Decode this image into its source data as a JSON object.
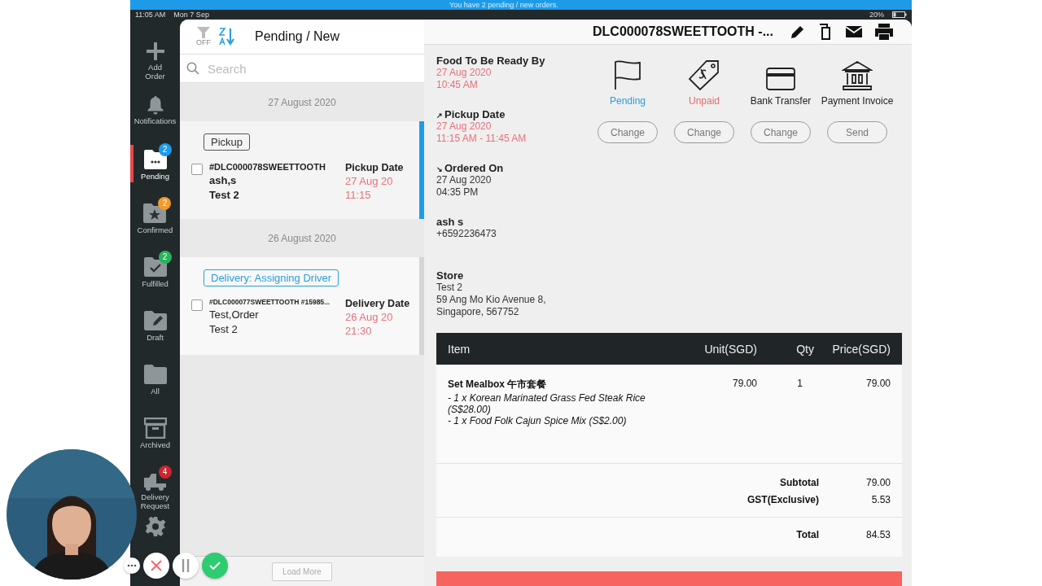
{
  "status_bar": {
    "banner": "You have 2 pending / new orders.",
    "time": "11:05 AM",
    "date": "Mon 7 Sep",
    "battery": "20%"
  },
  "sidebar": {
    "items": [
      {
        "kind": "plus",
        "label": "Add Order",
        "selected": false
      },
      {
        "kind": "bell",
        "label": "Notifications",
        "selected": false
      },
      {
        "kind": "folder-dots",
        "label": "Pending",
        "badge": "2",
        "color": "#1e9be8",
        "selected": true
      },
      {
        "kind": "folder-star",
        "label": "Confirmed",
        "badge": "2",
        "color": "#f39a2b",
        "selected": false
      },
      {
        "kind": "folder-check",
        "label": "Fulfilled",
        "badge": "2",
        "color": "#27b45a",
        "selected": false
      },
      {
        "kind": "folder-pencil",
        "label": "Draft",
        "selected": false
      },
      {
        "kind": "folder",
        "label": "All",
        "selected": false
      },
      {
        "kind": "box",
        "label": "Archived",
        "selected": false
      },
      {
        "kind": "truck",
        "label": "Delivery Request",
        "badge": "4",
        "color": "#d0242c",
        "selected": false
      },
      {
        "kind": "gear",
        "selected": false
      }
    ]
  },
  "order_list": {
    "filter_label": "OFF",
    "title": "Pending / New",
    "search": {
      "placeholder": "Search"
    },
    "groups": [
      {
        "date": "27 August 2020",
        "orders": [
          {
            "tag": "Pickup",
            "kind": "pickup",
            "id": "#DLC000078SWEETTOOTH",
            "customer": "ash,s",
            "store": "Test 2",
            "date_label": "Pickup Date",
            "date": "27 Aug 20",
            "time": "11:15",
            "checked": false,
            "unread": true,
            "selected": true
          }
        ]
      },
      {
        "date": "26 August 2020",
        "orders": [
          {
            "tag": "Delivery: Assigning Driver",
            "kind": "delivery",
            "id": "#DLC000077SWEETTOOTH #15985...",
            "customer": "Test,Order",
            "store": "Test 2",
            "date_label": "Delivery Date",
            "date": "26 Aug 20",
            "time": "21:30",
            "checked": false,
            "unread": false,
            "selected": false
          }
        ]
      }
    ],
    "load_more": "Load More"
  },
  "detail": {
    "title": "DLC000078SWEETTOOTH -...",
    "toolbar": [
      {
        "kind": "pencil"
      },
      {
        "kind": "copy"
      },
      {
        "kind": "mail"
      },
      {
        "kind": "print"
      }
    ],
    "info": [
      {
        "label": "Food To Be Ready By",
        "lines": [
          "27 Aug 2020",
          "10:45 AM"
        ],
        "highlight": true
      },
      {
        "prefix": "↗",
        "label": "Pickup Date",
        "lines": [
          "27 Aug 2020",
          "11:15 AM - 11:45 AM"
        ],
        "highlight": true
      },
      {
        "prefix": "↘",
        "label": "Ordered On",
        "lines": [
          "27 Aug 2020",
          "04:35 PM"
        ],
        "highlight": false
      },
      {
        "label": "ash s",
        "lines": [
          "+6592236473"
        ],
        "highlight": false
      },
      {
        "label": "Store",
        "lines": [
          "Test 2",
          "59 Ang Mo Kio Avenue 8,",
          "Singapore, 567752"
        ],
        "highlight": false
      }
    ],
    "actions": [
      {
        "kind": "flag",
        "label": "Pending",
        "color": "#2a9fd8",
        "button": "Change"
      },
      {
        "kind": "tag",
        "label": "Unpaid",
        "color": "#e86a6a",
        "button": "Change"
      },
      {
        "kind": "card",
        "label": "Bank Transfer",
        "color": "#222222",
        "button": "Change"
      },
      {
        "kind": "bank",
        "label": "Payment Invoice",
        "color": "#222222",
        "button": "Send"
      }
    ],
    "table": {
      "columns": [
        "Item",
        "Unit(SGD)",
        "Qty",
        "Price(SGD)"
      ],
      "rows": [
        {
          "name": "Set Mealbox 午市套餐",
          "options": [
            "- 1 x Korean Marinated Grass Fed Steak Rice (S$28.00)",
            "- 1 x Food Folk Cajun Spice Mix (S$2.00)"
          ],
          "unit": "79.00",
          "qty": "1",
          "price": "79.00"
        }
      ],
      "summary": [
        {
          "label": "Subtotal",
          "value": "79.00"
        },
        {
          "label": "GST(Exclusive)",
          "value": "5.53"
        }
      ],
      "total": {
        "label": "Total",
        "value": "84.53"
      }
    }
  },
  "recorder": [
    {
      "kind": "more"
    },
    {
      "kind": "cancel"
    },
    {
      "kind": "pause"
    },
    {
      "kind": "done"
    }
  ]
}
